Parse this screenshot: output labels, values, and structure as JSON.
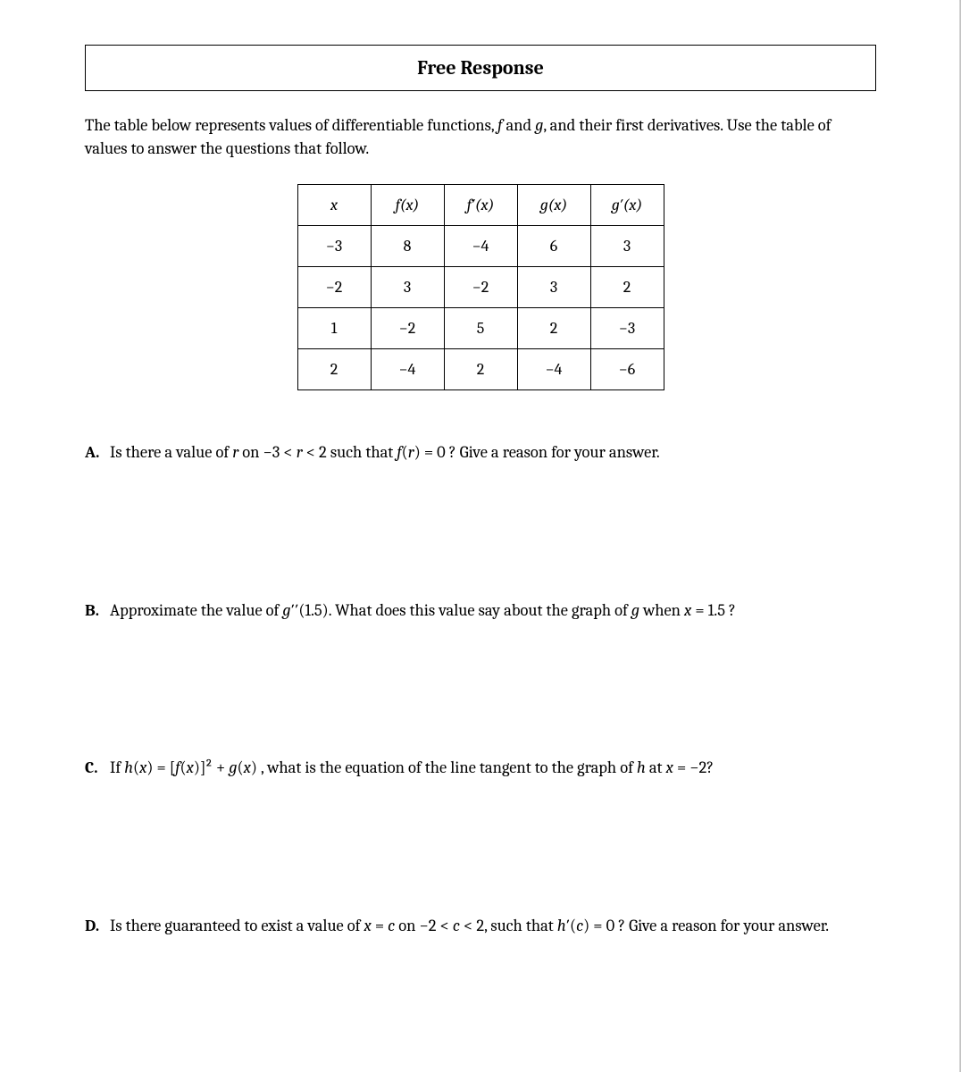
{
  "title": "Free Response",
  "intro_parts": {
    "p1": "The table below represents values of differentiable functions, ",
    "f": "f",
    "and": " and ",
    "g": "g",
    "p2": ", and their first derivatives. Use the table of values to answer the questions that follow."
  },
  "table": {
    "headers": [
      "x",
      "f(x)",
      "f′(x)",
      "g(x)",
      "g′(x)"
    ],
    "rows": [
      [
        "−3",
        "8",
        "−4",
        "6",
        "3"
      ],
      [
        "−2",
        "3",
        "−2",
        "3",
        "2"
      ],
      [
        "1",
        "−2",
        "5",
        "2",
        "−3"
      ],
      [
        "2",
        "−4",
        "2",
        "−4",
        "−6"
      ]
    ]
  },
  "questions": {
    "A": {
      "label": "A.",
      "p1": "Is there a value of ",
      "r": "r",
      "p2": " on −3  <  ",
      "r2": "r",
      "p3": "  <  2 such that ",
      "fr": "f",
      "p4": "(",
      "r3": "r",
      "p5": ")  =  0 ? Give a reason for your answer."
    },
    "B": {
      "label": "B.",
      "p1": "Approximate the value of ",
      "g": "g",
      "p2": "′′(1.5). What does this value say about the graph of ",
      "g2": "g",
      "p3": " when  ",
      "x": "x",
      "p4": " =  1.5 ?"
    },
    "C": {
      "label": "C.",
      "p1": "If  ",
      "h": "h",
      "p2": "(",
      "x1": "x",
      "p3": ") = [",
      "f": "f",
      "p4": "(",
      "x2": "x",
      "p5": ")]²  + ",
      "g": "g",
      "p6": "(",
      "x3": "x",
      "p7": ") , what is the equation of the line tangent to the graph of ",
      "h2": "h",
      "p8": " at ",
      "x4": "x",
      "p9": "  =  −2?"
    },
    "D": {
      "label": "D.",
      "p1": "Is there guaranteed to exist a value of ",
      "x1": "x",
      "p2": " = ",
      "c1": "c",
      "p3": " on −2  <  ",
      "c2": "c",
      "p4": "  <  2, such that ",
      "h": "h",
      "p5": "′(",
      "c3": "c",
      "p6": ") =  0 ? Give a reason for your answer."
    }
  }
}
